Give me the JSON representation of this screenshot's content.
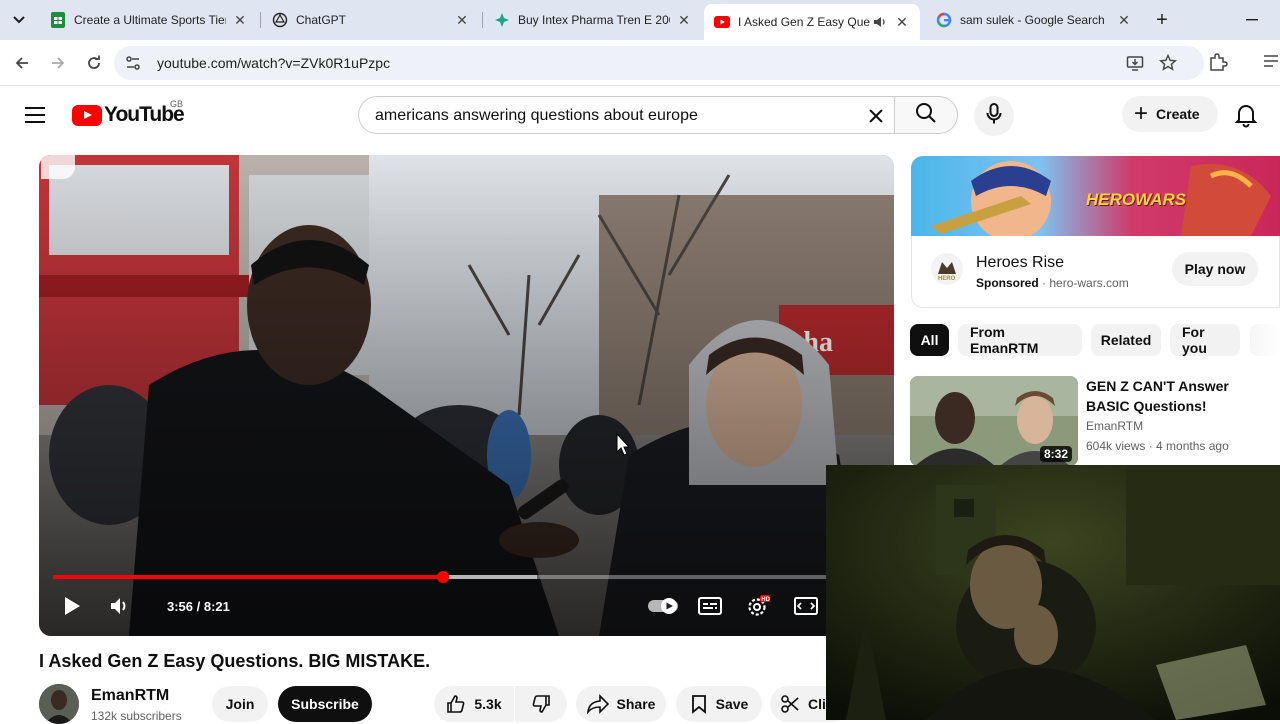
{
  "browser": {
    "tabs": [
      {
        "title": "Create a Ultimate Sports Tier",
        "icon": "sheets-icon"
      },
      {
        "title": "ChatGPT",
        "icon": "chatgpt-icon"
      },
      {
        "title": "Buy Intex Pharma Tren E 200",
        "icon": "pharma-icon"
      },
      {
        "title": "I Asked Gen Z Easy Ques",
        "icon": "youtube-icon",
        "active": true,
        "audio": true
      },
      {
        "title": "sam sulek - Google Search",
        "icon": "google-icon"
      }
    ],
    "url": "youtube.com/watch?v=ZVk0R1uPzpc"
  },
  "youtube": {
    "logo_text": "YouTube",
    "region": "GB",
    "search_query": "americans answering questions about europe",
    "create_label": "Create"
  },
  "player": {
    "time_display": "3:56 / 8:21",
    "progress_fraction": 0.4711,
    "buffered_fraction": 0.5845,
    "hd_badge": "HD"
  },
  "video": {
    "title": "I Asked Gen Z Easy Questions. BIG MISTAKE.",
    "channel": "EmanRTM",
    "subscribers": "132k subscribers",
    "join_label": "Join",
    "subscribe_label": "Subscribe",
    "likes": "5.3k",
    "share_label": "Share",
    "save_label": "Save",
    "clip_label": "Cli"
  },
  "ad": {
    "banner_text": "HEROWARS",
    "title": "Heroes Rise",
    "sponsored": "Sponsored",
    "domain": "hero-wars.com",
    "cta": "Play now"
  },
  "chips": [
    "All",
    "From EmanRTM",
    "Related",
    "For you"
  ],
  "recommendation": {
    "title": "GEN Z CAN'T Answer BASIC Questions!",
    "channel": "EmanRTM",
    "meta": "604k views · 4 months ago",
    "duration": "8:32"
  },
  "colors": {
    "youtube_red": "#ff0000",
    "tabstrip": "#dfe5f1",
    "omnibox": "#eef1f8"
  }
}
